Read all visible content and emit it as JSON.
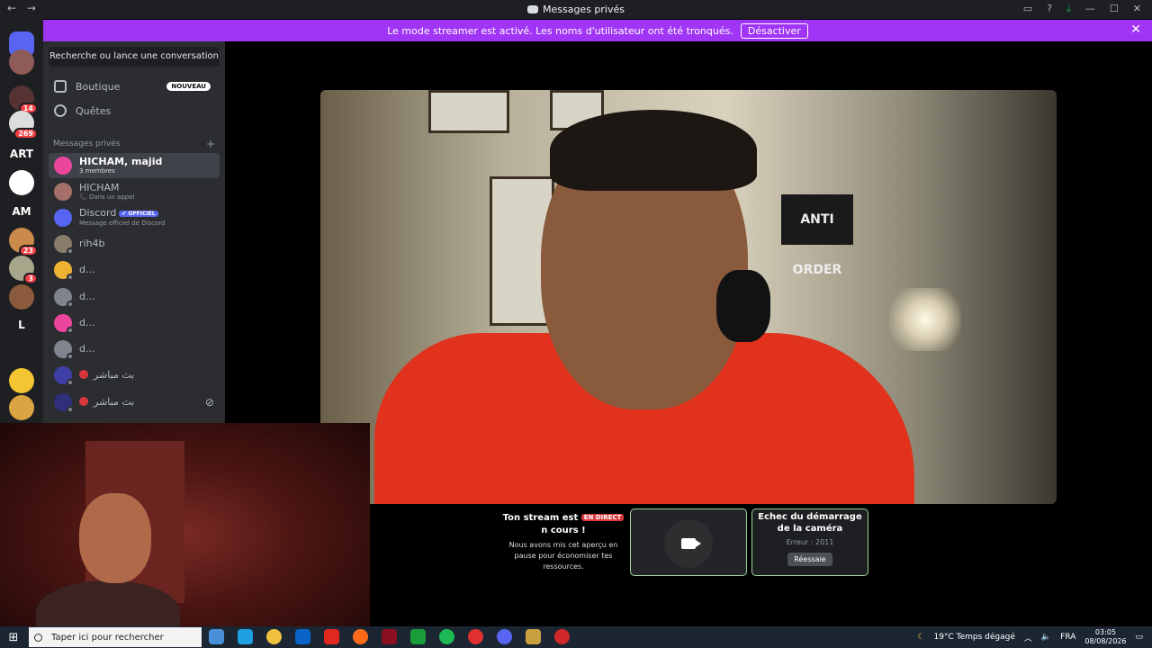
{
  "window": {
    "nav_back": "←",
    "nav_forward": "→",
    "title": "Messages privés",
    "controls": [
      "inbox-icon",
      "help-icon",
      "download-icon",
      "—",
      "☐",
      "✕"
    ]
  },
  "banner": {
    "text": "Le mode streamer est activé. Les noms d'utilisateur ont été tronqués.",
    "button": "Désactiver",
    "close": "✕",
    "color": "#a035f5"
  },
  "guilds": [
    {
      "name": "discord-home",
      "label": "",
      "color": "#5865f2"
    },
    {
      "name": "server-avatar",
      "label": "",
      "color": "#8e5b58"
    },
    {
      "name": "server-1",
      "label": "",
      "color": "#553333",
      "badge": "14"
    },
    {
      "name": "server-2",
      "label": "",
      "color": "#dddddd",
      "badge": "269"
    },
    {
      "name": "server-art",
      "label": "ART",
      "color": "#1e1f22"
    },
    {
      "name": "server-3",
      "label": "",
      "color": "#ffffff"
    },
    {
      "name": "server-am",
      "label": "AM",
      "color": "#1e1f22"
    },
    {
      "name": "server-4",
      "label": "",
      "color": "#c98a4b",
      "badge": "23"
    },
    {
      "name": "server-5",
      "label": "",
      "color": "#a7a68b",
      "badge": "3"
    },
    {
      "name": "server-6",
      "label": "",
      "color": "#8b5a3c"
    },
    {
      "name": "server-l",
      "label": "L",
      "color": "#1e1f22"
    },
    {
      "name": "server-7",
      "label": "",
      "color": "#1e1f22"
    },
    {
      "name": "server-8",
      "label": "",
      "color": "#f3c532"
    },
    {
      "name": "server-9",
      "label": "",
      "color": "#d9a441"
    }
  ],
  "sidebar": {
    "search": "Recherche ou lance une conversation",
    "boutique": "Boutique",
    "nouveau": "NOUVEAU",
    "quetes": "Quêtes",
    "section": "Messages privés",
    "add": "+",
    "dms": [
      {
        "name": "HICHAM, majid",
        "sub": "3 membres",
        "color": "#eb459e"
      },
      {
        "name": "HICHAM",
        "sub": "📞 Dans un appel",
        "color": "#a5706a"
      },
      {
        "name": "Discord",
        "official": "✔ OFFICIEL",
        "sub": "Message officiel de Discord",
        "color": "#5865f2"
      },
      {
        "name": "rih4b",
        "sub": "",
        "color": "#8a7c6a"
      },
      {
        "name": "d...",
        "sub": "",
        "color": "#f0b232"
      },
      {
        "name": "d...",
        "sub": "",
        "color": "#80848e"
      },
      {
        "name": "d...",
        "sub": "",
        "color": "#eb459e"
      },
      {
        "name": "d...",
        "sub": "",
        "color": "#80848e"
      },
      {
        "name": "بث مباشر",
        "sub": "",
        "color": "#3f3fa8"
      },
      {
        "name": "بث مباشر",
        "sub": "",
        "color": "#2f2f7a"
      }
    ]
  },
  "stage": {
    "poster_text": "ANTI ORDER"
  },
  "stream_notice": {
    "title_pre": "Ton stream est",
    "live": "EN DIRECT",
    "title_post": "n cours !",
    "desc": "Nous avons mis cet aperçu en pause pour économiser tes ressources."
  },
  "camera_error": {
    "title": "Echec du démarrage de la caméra",
    "error": "Erreur : 2011",
    "retry": "Réessaie"
  },
  "taskbar": {
    "search": "Taper ici pour rechercher",
    "weather": "19°C  Temps dégagé",
    "lang": "FRA",
    "time": "03:05",
    "date": "08/08/2026",
    "apps": [
      "#4a90d9",
      "#1fa0e0",
      "#f0c040",
      "#0a64c8",
      "#e0281e",
      "#ff6a1a",
      "#8a1020",
      "#1a9c3a",
      "#1db954",
      "#e03030",
      "#5865f2",
      "#c8a040",
      "#d02828"
    ]
  }
}
